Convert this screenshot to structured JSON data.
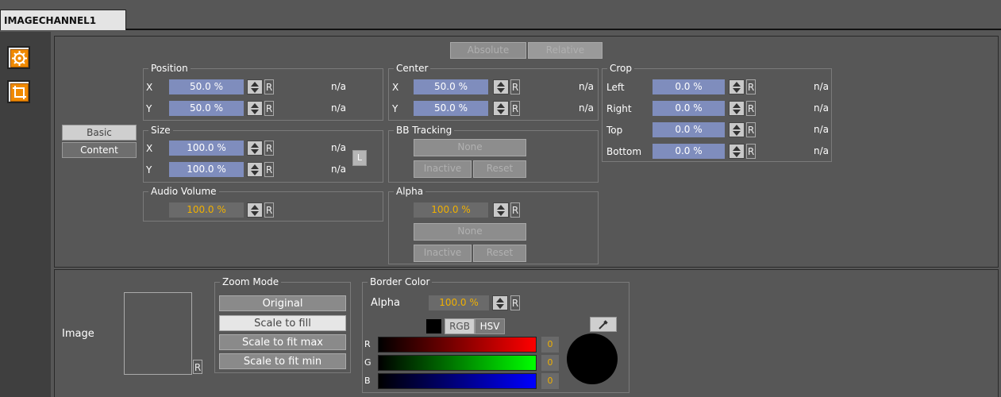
{
  "tab": {
    "title": "IMAGECHANNEL1"
  },
  "sidebar": {
    "items": [
      {
        "icon": "gear-icon"
      },
      {
        "icon": "crop-icon"
      }
    ]
  },
  "mode": {
    "absolute": "Absolute",
    "relative": "Relative"
  },
  "side_tabs": {
    "basic": "Basic",
    "content": "Content"
  },
  "position": {
    "title": "Position",
    "x": {
      "label": "X",
      "value": "50.0 %",
      "reset": "R",
      "status": "n/a"
    },
    "y": {
      "label": "Y",
      "value": "50.0 %",
      "reset": "R",
      "status": "n/a"
    }
  },
  "size": {
    "title": "Size",
    "x": {
      "label": "X",
      "value": "100.0 %",
      "reset": "R",
      "status": "n/a"
    },
    "y": {
      "label": "Y",
      "value": "100.0 %",
      "reset": "R",
      "status": "n/a"
    },
    "lock": "L"
  },
  "audio": {
    "title": "Audio Volume",
    "value": "100.0 %",
    "reset": "R"
  },
  "center": {
    "title": "Center",
    "x": {
      "label": "X",
      "value": "50.0 %",
      "reset": "R",
      "status": "n/a"
    },
    "y": {
      "label": "Y",
      "value": "50.0 %",
      "reset": "R",
      "status": "n/a"
    }
  },
  "bb_tracking": {
    "title": "BB Tracking",
    "none": "None",
    "inactive": "Inactive",
    "reset": "Reset"
  },
  "alpha": {
    "title": "Alpha",
    "value": "100.0 %",
    "reset_r": "R",
    "none": "None",
    "inactive": "Inactive",
    "reset": "Reset"
  },
  "crop": {
    "title": "Crop",
    "rows": [
      {
        "label": "Left",
        "value": "0.0 %",
        "reset": "R",
        "status": "n/a"
      },
      {
        "label": "Right",
        "value": "0.0 %",
        "reset": "R",
        "status": "n/a"
      },
      {
        "label": "Top",
        "value": "0.0 %",
        "reset": "R",
        "status": "n/a"
      },
      {
        "label": "Bottom",
        "value": "0.0 %",
        "reset": "R",
        "status": "n/a"
      }
    ]
  },
  "image": {
    "label": "Image",
    "reset": "R"
  },
  "zoom": {
    "title": "Zoom Mode",
    "options": [
      "Original",
      "Scale to fill",
      "Scale to fit max",
      "Scale to fit min"
    ],
    "selected": "Scale to fill"
  },
  "border_color": {
    "title": "Border Color",
    "alpha_label": "Alpha",
    "alpha_value": "100.0 %",
    "alpha_reset": "R",
    "rgb": "RGB",
    "hsv": "HSV",
    "channels": [
      {
        "label": "R",
        "value": "0",
        "color": "#ff0000"
      },
      {
        "label": "G",
        "value": "0",
        "color": "#00ff00"
      },
      {
        "label": "B",
        "value": "0",
        "color": "#0000ff"
      }
    ],
    "swatch": "#000000",
    "eyedropper_icon": "eyedropper-icon"
  }
}
